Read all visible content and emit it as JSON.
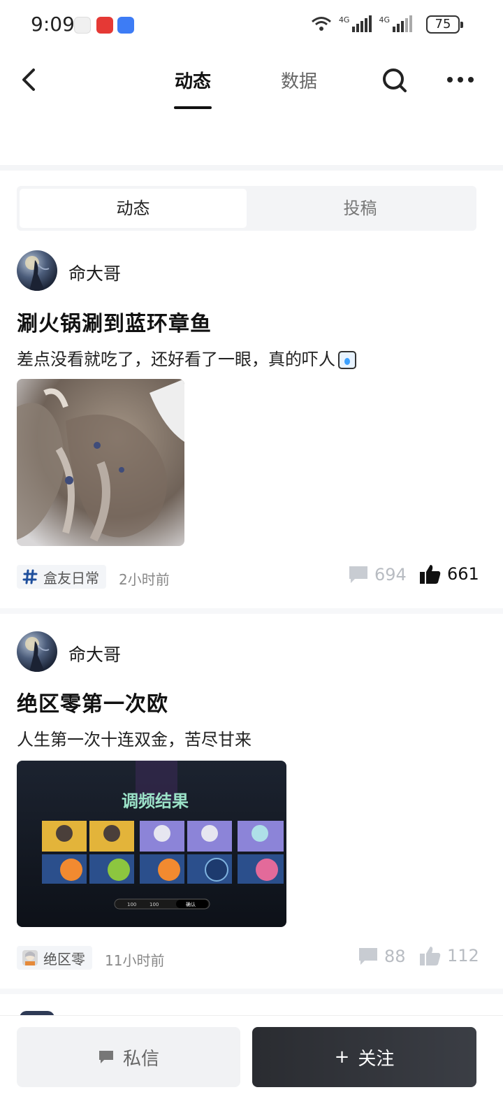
{
  "status_bar": {
    "time": "9:09",
    "battery": "75",
    "network_1": "4G",
    "network_2": "4G"
  },
  "nav": {
    "tabs": [
      {
        "label": "动态",
        "active": true
      },
      {
        "label": "数据",
        "active": false
      }
    ],
    "icons": [
      "back-icon",
      "search-icon",
      "more-icon"
    ]
  },
  "segment": {
    "items": [
      {
        "label": "动态",
        "active": true
      },
      {
        "label": "投稿",
        "active": false
      }
    ]
  },
  "posts": [
    {
      "author": "命大哥",
      "title": "涮火锅涮到蓝环章鱼",
      "body": "差点没看就吃了，还好看了一眼，真的吓人",
      "tag": "盒友日常",
      "time": "2小时前",
      "comments": "694",
      "likes": "661",
      "liked": true
    },
    {
      "author": "命大哥",
      "title": "绝区零第一次欧",
      "body": "人生第一次十连双金，苦尽甘来",
      "tag": "绝区零",
      "time": "11小时前",
      "comments": "88",
      "likes": "112",
      "liked": false,
      "image_title": "调频结果",
      "image_counts": [
        "100",
        "100"
      ],
      "image_button": "确认"
    }
  ],
  "bottom": {
    "dm_label": "私信",
    "follow_label": "关注",
    "follow_plus": "+"
  },
  "colors": {
    "tag_hash": "#1f4f9c",
    "follow_bg": "#2c2f35",
    "dm_bg": "#f1f2f4"
  }
}
